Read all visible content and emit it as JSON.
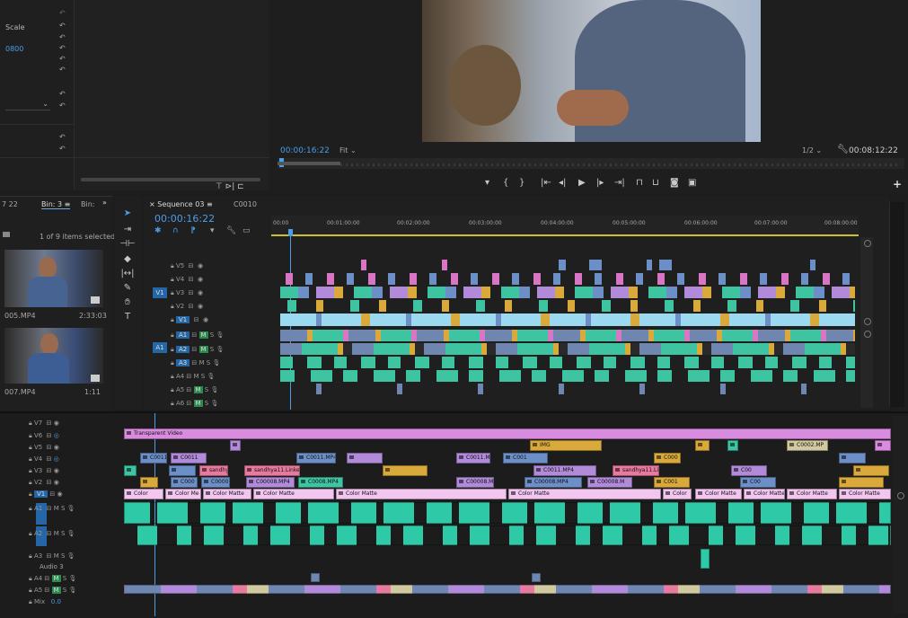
{
  "effect_controls": {
    "labels": [
      "Scale",
      "0800"
    ],
    "reset_icons": 11
  },
  "program_monitor": {
    "timecode": "00:00:16:22",
    "fit": "Fit",
    "resolution": "1/2",
    "duration": "00:08:12:22",
    "transport": [
      "marker-icon",
      "mark-in-icon",
      "mark-out-icon",
      "go-to-in-icon",
      "step-back-icon",
      "play-icon",
      "step-forward-icon",
      "go-to-out-icon",
      "lift-icon",
      "extract-icon",
      "camera-icon",
      "compare-icon"
    ],
    "add_button": "+"
  },
  "project": {
    "tab_left": "7 22",
    "tab_bin3": "Bin: 3",
    "tab_bin": "Bin:",
    "selection": "1 of 9 items selected",
    "items": [
      {
        "name": "005.MP4",
        "duration": "2:33:03"
      },
      {
        "name": "007.MP4",
        "duration": "1:11"
      }
    ]
  },
  "tools": [
    "selection-tool",
    "track-select-tool",
    "ripple-edit-tool",
    "razor-tool",
    "slip-tool",
    "pen-tool",
    "hand-tool",
    "type-tool"
  ],
  "sequence": {
    "tab": "Sequence 03",
    "tab2": "C0010",
    "timecode": "00:00:16:22",
    "ruler": [
      "00:00",
      "00:01:00:00",
      "00:02:00:00",
      "00:03:00:00",
      "00:04:00:00",
      "00:05:00:00",
      "00:06:00:00",
      "00:07:00:00",
      "00:08:00:00"
    ],
    "video_tracks": [
      "V5",
      "V4",
      "V3",
      "V2",
      "V1"
    ],
    "audio_tracks": [
      "A1",
      "A2",
      "A3",
      "A4",
      "A5",
      "A6"
    ],
    "src_v": "V1",
    "src_a": "A1"
  },
  "lower_timeline": {
    "video_tracks": [
      "V7",
      "V6",
      "V5",
      "V4",
      "V3",
      "V2",
      "V1"
    ],
    "audio_tracks": [
      "A1",
      "A2",
      "A3",
      "A4",
      "A5",
      "Mix"
    ],
    "audio3_label": "Audio 3",
    "mix_value": "0.0",
    "clip_labels": {
      "transparent": "Transparent Video",
      "c0011": "C0011",
      "c0011mp4": "C0011.MP4",
      "c0011m": "C0011.M",
      "c001": "C001",
      "img": "IMG",
      "c0002mp": "C0002.MP",
      "sandhy": "sandhy",
      "sandhya11": "sandhya11.Linked",
      "c0011mp4b": "C0011.MP4",
      "sandhya11b": "sandhya11.Li",
      "c0008mp4": "C0008.MP4",
      "c0008": "C00008.MP4",
      "c0008m": "C00008.M",
      "c000": "C000",
      "c00": "C00",
      "color": "Color",
      "colorme": "Color Me",
      "colormatte": "Color Matte"
    }
  }
}
